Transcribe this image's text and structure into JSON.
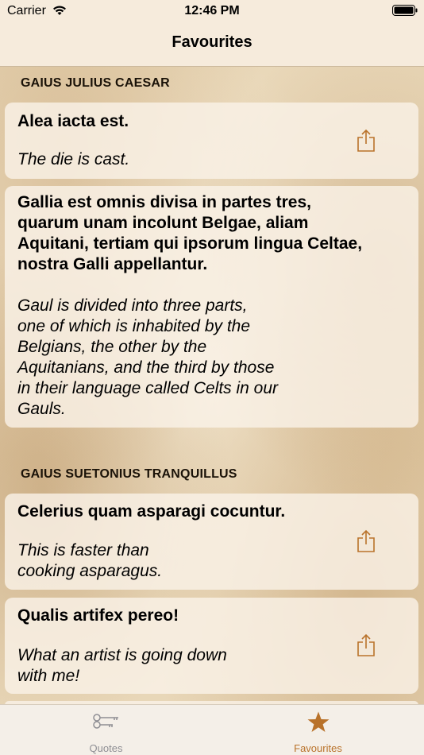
{
  "status": {
    "carrier": "Carrier",
    "time": "12:46 PM"
  },
  "nav": {
    "title": "Favourites"
  },
  "sections": [
    {
      "header": "GAIUS JULIUS CAESAR",
      "quotes": [
        {
          "latin": "Alea iacta est.",
          "english": "The die is cast."
        },
        {
          "latin": "Gallia est omnis divisa in partes tres,\nquarum unam incolunt Belgae, aliam\nAquitani, tertiam qui ipsorum lingua Celtae,\nnostra Galli appellantur.",
          "english": "Gaul is divided into three parts,\none of which is inhabited by the\nBelgians, the other by the\nAquitanians, and the third by those\nin their language called Celts in our\nGauls."
        }
      ]
    },
    {
      "header": "GAIUS SUETONIUS TRANQUILLUS",
      "quotes": [
        {
          "latin": "Celerius quam asparagi cocuntur.",
          "english": "This is faster than\ncooking asparagus."
        },
        {
          "latin": "Qualis artifex pereo!",
          "english": "What an artist is going down\nwith me!"
        }
      ]
    }
  ],
  "tabs": [
    {
      "label": "Quotes",
      "icon": "keys-icon",
      "selected": false
    },
    {
      "label": "Favourites",
      "icon": "star-icon",
      "selected": true
    }
  ],
  "colors": {
    "accent": "#b9722a",
    "inactive": "#8e8e93"
  }
}
